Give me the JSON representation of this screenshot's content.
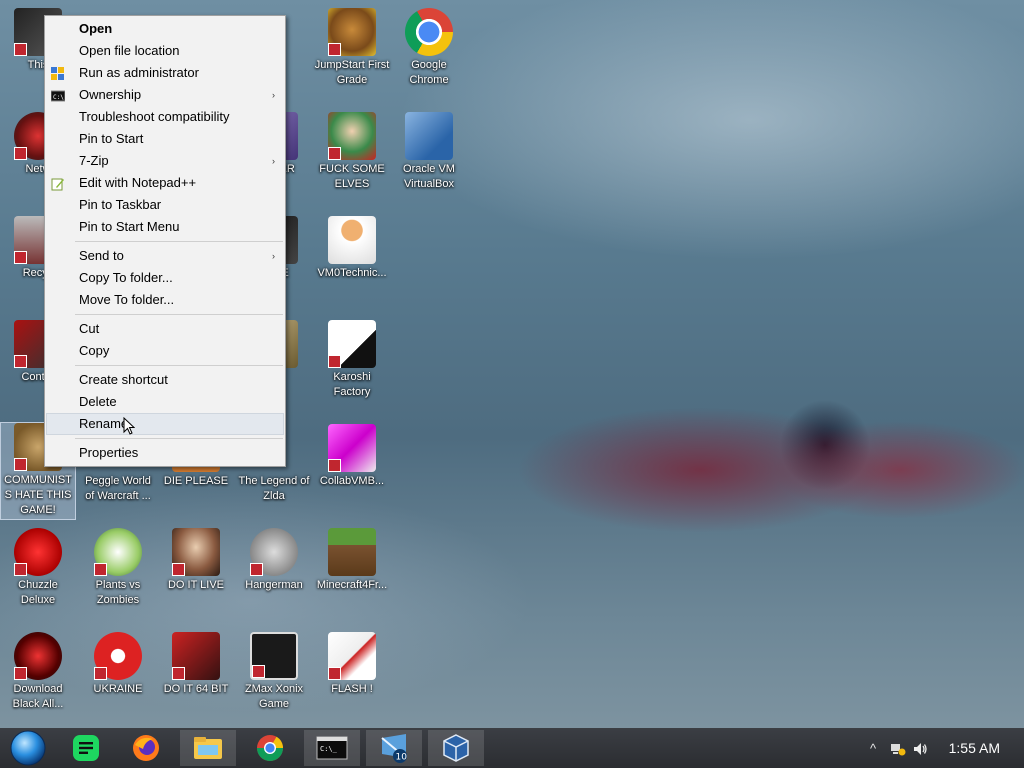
{
  "context_menu": {
    "items": [
      {
        "label": "Open",
        "bold": true
      },
      {
        "label": "Open file location"
      },
      {
        "label": "Run as administrator",
        "icon": "shield-icon"
      },
      {
        "label": "Ownership",
        "icon": "cmd-icon",
        "submenu": true
      },
      {
        "label": "Troubleshoot compatibility"
      },
      {
        "label": "Pin to Start"
      },
      {
        "label": "7-Zip",
        "submenu": true
      },
      {
        "label": "Edit with Notepad++",
        "icon": "notepad-icon"
      },
      {
        "label": "Pin to Taskbar"
      },
      {
        "label": "Pin to Start Menu"
      },
      {
        "label": "Send to",
        "submenu": true
      },
      {
        "label": "Copy To folder..."
      },
      {
        "label": "Move To folder..."
      },
      {
        "label": "Cut"
      },
      {
        "label": "Copy"
      },
      {
        "label": "Create shortcut"
      },
      {
        "label": "Delete"
      },
      {
        "label": "Rename",
        "hovered": true
      },
      {
        "label": "Properties"
      }
    ],
    "submenu_arrow": "›"
  },
  "desktop_icons": {
    "col1": [
      {
        "label": "This"
      },
      {
        "label": "Netw"
      },
      {
        "label": "Recyc"
      },
      {
        "label": "Contro"
      },
      {
        "label": "COMMUNISTS HATE THIS GAME!",
        "selected": true
      },
      {
        "label": "Chuzzle Deluxe"
      },
      {
        "label": "Download Black All..."
      }
    ],
    "col2": [
      {
        "label": "Peggle World of Warcraft ..."
      },
      {
        "label": "Plants vs Zombies"
      },
      {
        "label": "UKRAINE"
      }
    ],
    "col3": [
      {
        "label": "DIE PLEASE"
      },
      {
        "label": "DO IT LIVE"
      },
      {
        "label": "DO IT 64 BIT"
      }
    ],
    "col4": [
      {
        "label": "ARD ER"
      },
      {
        "label": "YPSE"
      },
      {
        "label": "lda"
      },
      {
        "label": "The Legend of Zlda"
      },
      {
        "label": "Hangerman"
      },
      {
        "label": "ZMax Xonix Game"
      }
    ],
    "col5": [
      {
        "label": "JumpStart First Grade"
      },
      {
        "label": "FUCK SOME ELVES"
      },
      {
        "label": "VM0Technic..."
      },
      {
        "label": "Karoshi Factory"
      },
      {
        "label": "CollabVMB..."
      },
      {
        "label": "Minecraft4Fr..."
      },
      {
        "label": "FLASH !"
      }
    ],
    "col6": [
      {
        "label": "Google Chrome"
      },
      {
        "label": "Oracle VM VirtualBox"
      }
    ]
  },
  "taskbar": {
    "items": [
      {
        "name": "start-button"
      },
      {
        "name": "spotify-icon"
      },
      {
        "name": "firefox-icon"
      },
      {
        "name": "file-explorer-icon"
      },
      {
        "name": "chrome-icon"
      },
      {
        "name": "command-prompt-icon"
      },
      {
        "name": "windows-10-icon"
      },
      {
        "name": "virtualbox-icon"
      }
    ],
    "tray": {
      "chevron": "^",
      "clock": "1:55 AM"
    }
  },
  "colors": {
    "menu_bg": "#f2f2f2",
    "menu_hover": "#e3e8ee",
    "taskbar": "#2b2d31",
    "badge": "#c0262f"
  }
}
